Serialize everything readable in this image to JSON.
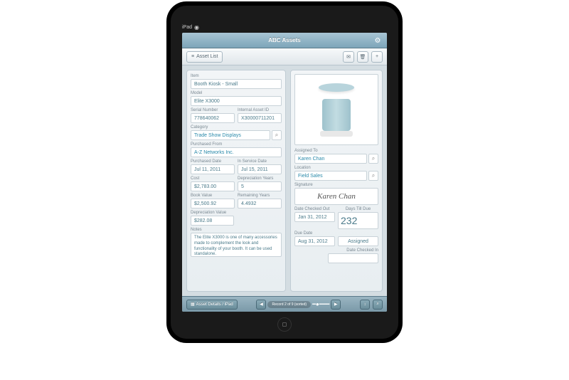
{
  "status": {
    "carrier": "iPad"
  },
  "titlebar": {
    "title": "ABC Assets"
  },
  "toolbar": {
    "asset_list": "Asset List"
  },
  "left": {
    "item_lbl": "Item",
    "item": "Booth Kiosk - Small",
    "model_lbl": "Model",
    "model": "Elite X3000",
    "serial_lbl": "Serial Number",
    "serial": "778640062",
    "assetid_lbl": "Internal Asset ID",
    "assetid": "X30000711201",
    "category_lbl": "Category",
    "category": "Trade Show Displays",
    "purchased_from_lbl": "Purchased From",
    "purchased_from": "A-Z Networks Inc.",
    "purchased_date_lbl": "Purchased Date",
    "purchased_date": "Jul 11, 2011",
    "inservice_lbl": "In Service Date",
    "inservice": "Jul 15, 2011",
    "cost_lbl": "Cost",
    "cost": "$2,783.00",
    "dep_years_lbl": "Depreciation Years",
    "dep_years": "5",
    "book_lbl": "Book Value",
    "book": "$2,500.92",
    "remain_lbl": "Remaining Years",
    "remain": "4.4932",
    "dep_val_lbl": "Depreciation Value",
    "dep_val": "$282.08",
    "notes_lbl": "Notes",
    "notes": "The Elite X3000 is one of many accessories made to complement the look and functionality of your booth. It can be used standalone."
  },
  "right": {
    "assigned_lbl": "Assigned To",
    "assigned": "Karen Chan",
    "location_lbl": "Location",
    "location": "Field Sales",
    "signature_lbl": "Signature",
    "signature": "Karen Chan",
    "checkout_lbl": "Date Checked Out",
    "checkout": "Jan 31, 2012",
    "days_lbl": "Days Till Due",
    "days": "232",
    "due_lbl": "Due Date",
    "due": "Aug 31, 2012",
    "status": "Assigned",
    "checkin_lbl": "Date Checked In"
  },
  "footer": {
    "left": "Asset Details / iPad",
    "center": "Record 2 of 9 (sorted)"
  }
}
